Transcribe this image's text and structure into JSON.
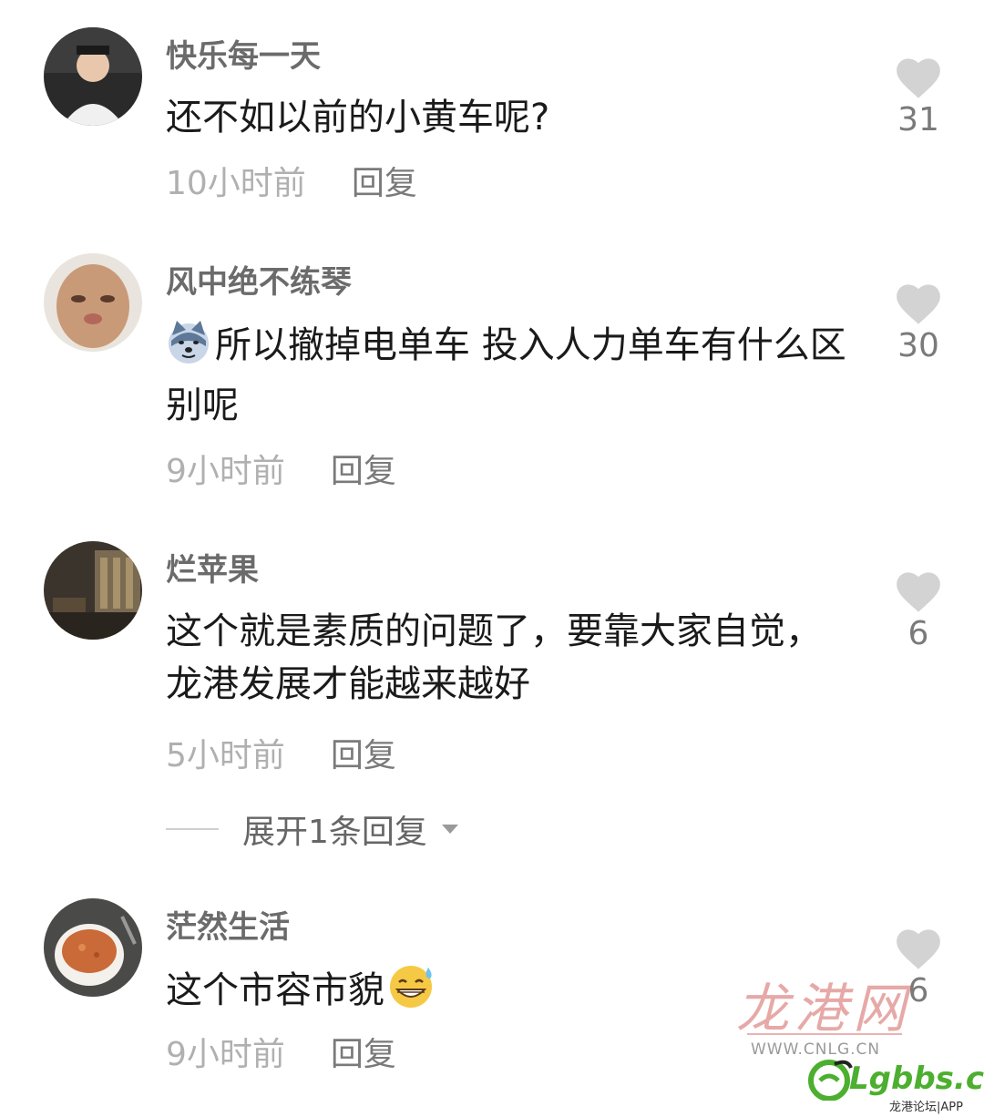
{
  "comments": [
    {
      "username": "快乐每一天",
      "text": "还不如以前的小黄车呢?",
      "time": "10小时前",
      "reply": "回复",
      "likes": "31"
    },
    {
      "username": "风中绝不练琴",
      "text": "所以撤掉电单车 投入人力单车有什么区别呢",
      "time": "9小时前",
      "reply": "回复",
      "likes": "30"
    },
    {
      "username": "烂苹果",
      "text": "这个就是素质的问题了，要靠大家自觉，龙港发展才能越来越好",
      "time": "5小时前",
      "reply": "回复",
      "likes": "6"
    },
    {
      "username": "茫然生活",
      "text": "这个市容市貌",
      "time": "9小时前",
      "reply": "回复",
      "likes": "6"
    }
  ],
  "expand_replies": {
    "label": "展开1条回复"
  },
  "watermark": {
    "logo_text": "龙港网",
    "url": "WWW.CNLG.CN",
    "brand": "Lgbbs.cn",
    "brand_sub": "龙港论坛|APP"
  },
  "icons": {
    "like": "heart-icon",
    "expand": "caret-down-icon",
    "emoji_dog": "doge-emoji",
    "emoji_grin": "sweat-grin-emoji"
  },
  "colors": {
    "heart": "#d3d3d3",
    "username": "#6b6b6b",
    "time": "#b0b0b0",
    "watermark_red": "#c9423d",
    "brand_green": "#4caf2f"
  }
}
